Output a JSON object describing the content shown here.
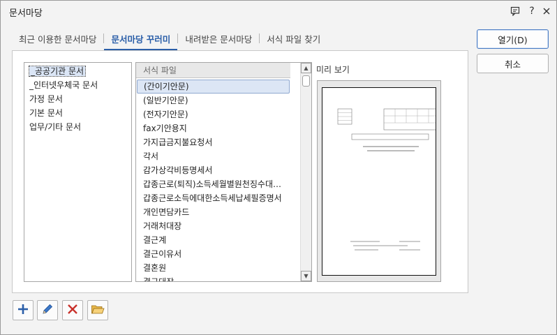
{
  "window": {
    "title": "문서마당"
  },
  "tabs": [
    {
      "label": "최근 이용한 문서마당"
    },
    {
      "label": "문서마당 꾸러미"
    },
    {
      "label": "내려받은 문서마당"
    },
    {
      "label": "서식 파일 찾기"
    }
  ],
  "categories": [
    {
      "label": "_공공기관 문서"
    },
    {
      "label": "_인터넷우체국 문서"
    },
    {
      "label": "가정 문서"
    },
    {
      "label": "기본 문서"
    },
    {
      "label": "업무/기타 문서"
    }
  ],
  "files": {
    "header": "서식 파일",
    "items": [
      {
        "label": "(간이기안문)"
      },
      {
        "label": "(일반기안문)"
      },
      {
        "label": "(전자기안문)"
      },
      {
        "label": "fax기안용지"
      },
      {
        "label": "가지급금지불요청서"
      },
      {
        "label": "각서"
      },
      {
        "label": "감가상각비등명세서"
      },
      {
        "label": "갑종근로(퇴직)소득세월별원천징수대…"
      },
      {
        "label": "갑종근로소득에대한소득세납세필증명서"
      },
      {
        "label": "개인면담카드"
      },
      {
        "label": "거래처대장"
      },
      {
        "label": "결근계"
      },
      {
        "label": "결근이유서"
      },
      {
        "label": "결혼원"
      },
      {
        "label": "결근대장"
      }
    ]
  },
  "preview": {
    "label": "미리 보기"
  },
  "buttons": {
    "open": "열기(D)",
    "cancel": "취소"
  },
  "toolbar_icons": [
    "add-icon",
    "edit-icon",
    "delete-icon",
    "open-folder-icon"
  ],
  "colors": {
    "accent": "#2a5ea8",
    "selection": "#dce6f5",
    "delete": "#c8312b"
  }
}
